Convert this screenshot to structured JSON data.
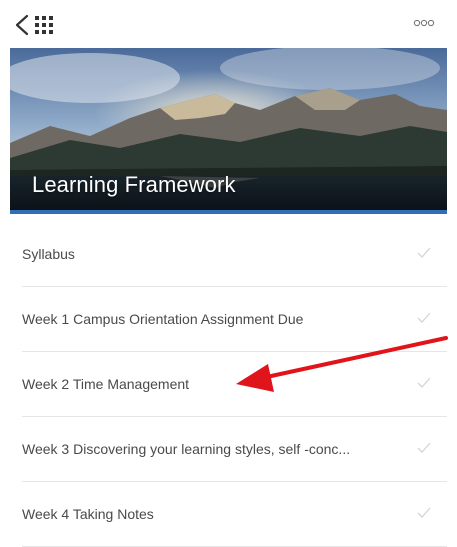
{
  "header": {
    "back_icon": "chevron-left-icon",
    "apps_icon": "grid-icon",
    "more_icon": "more-icon"
  },
  "banner": {
    "title": "Learning Framework",
    "accent_color": "#2f6fb5"
  },
  "items": [
    {
      "label": "Syllabus",
      "icon": "check-icon"
    },
    {
      "label": "Week 1 Campus Orientation Assignment Due",
      "icon": "check-icon"
    },
    {
      "label": "Week 2 Time Management",
      "icon": "check-icon"
    },
    {
      "label": "Week 3 Discovering your learning styles, self -conc...",
      "icon": "check-icon"
    },
    {
      "label": "Week 4 Taking Notes",
      "icon": "check-icon"
    }
  ],
  "annotation": {
    "arrow_color": "#e0141b"
  }
}
